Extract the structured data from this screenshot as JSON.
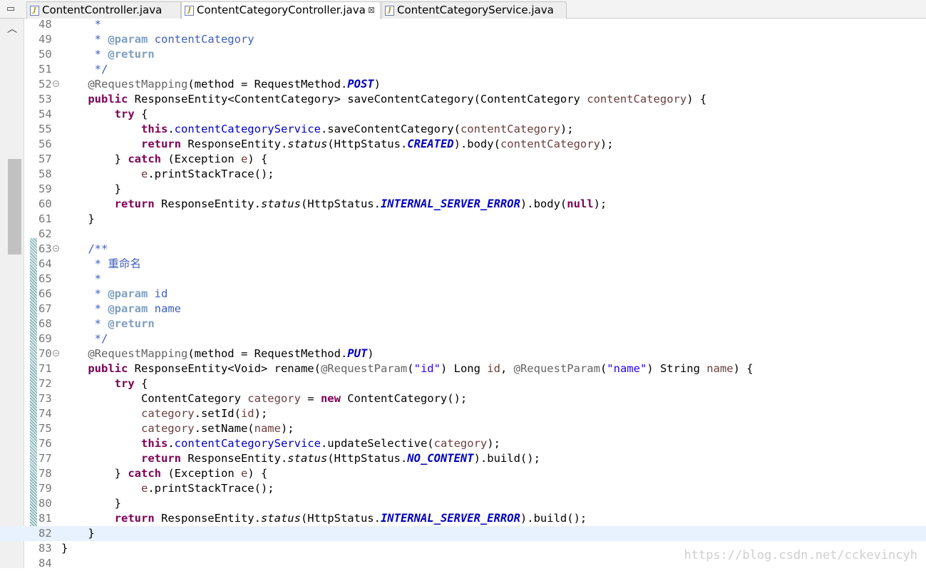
{
  "tabs": [
    {
      "label": "ContentController.java",
      "active": false
    },
    {
      "label": "ContentCategoryController.java",
      "active": true
    },
    {
      "label": "ContentCategoryService.java",
      "active": false
    }
  ],
  "tab_menu_icon": "minimize-icon",
  "close_glyph": "⊠",
  "watermark": "https://blog.csdn.net/cckevincyh",
  "colors": {
    "keyword": "#7f0055",
    "comment": "#3f5fbf",
    "javadoc_tag": "#7f9fbf",
    "field": "#0000c0",
    "local_var": "#6a3e3e",
    "string": "#2a00ff",
    "annotation": "#646464",
    "current_line": "#e8f2fe"
  },
  "editor": {
    "current_line": "82",
    "lines": [
      {
        "n": "48",
        "text": "     *"
      },
      {
        "n": "49",
        "text": "     * @param contentCategory"
      },
      {
        "n": "50",
        "text": "     * @return"
      },
      {
        "n": "51",
        "text": "     */"
      },
      {
        "n": "52",
        "text": "    @RequestMapping(method = RequestMethod.POST)",
        "fold": true
      },
      {
        "n": "53",
        "text": "    public ResponseEntity<ContentCategory> saveContentCategory(ContentCategory contentCategory) {"
      },
      {
        "n": "54",
        "text": "        try {"
      },
      {
        "n": "55",
        "text": "            this.contentCategoryService.saveContentCategory(contentCategory);"
      },
      {
        "n": "56",
        "text": "            return ResponseEntity.status(HttpStatus.CREATED).body(contentCategory);"
      },
      {
        "n": "57",
        "text": "        } catch (Exception e) {"
      },
      {
        "n": "58",
        "text": "            e.printStackTrace();"
      },
      {
        "n": "59",
        "text": "        }"
      },
      {
        "n": "60",
        "text": "        return ResponseEntity.status(HttpStatus.INTERNAL_SERVER_ERROR).body(null);"
      },
      {
        "n": "61",
        "text": "    }"
      },
      {
        "n": "62",
        "text": ""
      },
      {
        "n": "63",
        "text": "    /**",
        "fold": true
      },
      {
        "n": "64",
        "text": "     * 重命名"
      },
      {
        "n": "65",
        "text": "     *"
      },
      {
        "n": "66",
        "text": "     * @param id"
      },
      {
        "n": "67",
        "text": "     * @param name"
      },
      {
        "n": "68",
        "text": "     * @return"
      },
      {
        "n": "69",
        "text": "     */"
      },
      {
        "n": "70",
        "text": "    @RequestMapping(method = RequestMethod.PUT)",
        "fold": true
      },
      {
        "n": "71",
        "text": "    public ResponseEntity<Void> rename(@RequestParam(\"id\") Long id, @RequestParam(\"name\") String name) {"
      },
      {
        "n": "72",
        "text": "        try {"
      },
      {
        "n": "73",
        "text": "            ContentCategory category = new ContentCategory();"
      },
      {
        "n": "74",
        "text": "            category.setId(id);"
      },
      {
        "n": "75",
        "text": "            category.setName(name);"
      },
      {
        "n": "76",
        "text": "            this.contentCategoryService.updateSelective(category);"
      },
      {
        "n": "77",
        "text": "            return ResponseEntity.status(HttpStatus.NO_CONTENT).build();"
      },
      {
        "n": "78",
        "text": "        } catch (Exception e) {"
      },
      {
        "n": "79",
        "text": "            e.printStackTrace();"
      },
      {
        "n": "80",
        "text": "        }"
      },
      {
        "n": "81",
        "text": "        return ResponseEntity.status(HttpStatus.INTERNAL_SERVER_ERROR).build();"
      },
      {
        "n": "82",
        "text": "    }"
      },
      {
        "n": "83",
        "text": "}"
      },
      {
        "n": "84",
        "text": ""
      }
    ]
  }
}
